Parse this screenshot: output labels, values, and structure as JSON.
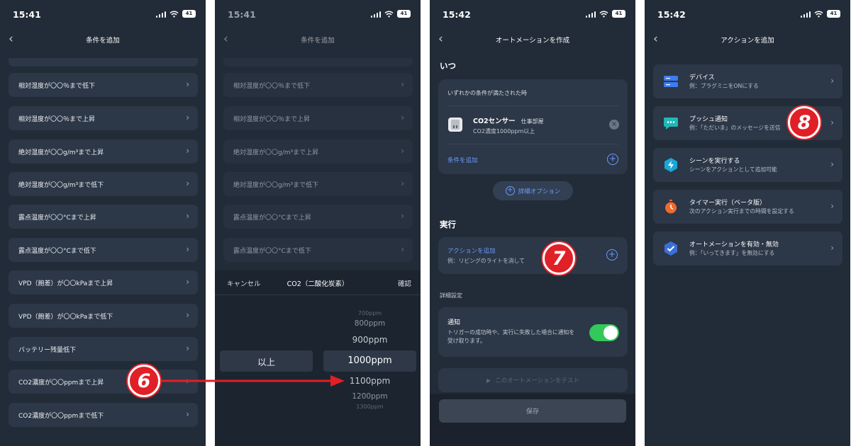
{
  "screens": [
    {
      "time": "15:41",
      "battery": "41",
      "title": "条件を追加",
      "rows": [
        "相対湿度が〇〇％まで低下",
        "相対湿度が〇〇％まで上昇",
        "絶対湿度が〇〇g/m³まで上昇",
        "絶対湿度が〇〇g/m³まで低下",
        "露点温度が〇〇°Cまで上昇",
        "露点温度が〇〇°Cまで低下",
        "VPD（飽差）が〇〇kPaまで上昇",
        "VPD（飽差）が〇〇kPaまで低下",
        "バッテリー残量低下",
        "CO2濃度が〇〇ppmまで上昇",
        "CO2濃度が〇〇ppmまで低下"
      ]
    },
    {
      "time": "15:41",
      "battery": "41",
      "title": "条件を追加",
      "rows": [
        "相対湿度が〇〇％まで低下",
        "相対湿度が〇〇％まで上昇",
        "絶対湿度が〇〇g/m³まで上昇",
        "絶対湿度が〇〇g/m³まで低下",
        "露点温度が〇〇°Cまで上昇",
        "露点温度が〇〇°Cまで低下"
      ],
      "picker": {
        "cancel": "キャンセル",
        "title": "CO2（二酸化炭素）",
        "confirm": "確認",
        "left_value": "以上",
        "values": [
          "700ppm",
          "800ppm",
          "900ppm",
          "1000ppm",
          "1100ppm",
          "1200ppm",
          "1300ppm"
        ],
        "selected": "1000ppm"
      }
    },
    {
      "time": "15:42",
      "battery": "41",
      "title": "オートメーションを作成",
      "when_header": "いつ",
      "when_mode": "いずれかの条件が満たされた時",
      "condition_name": "CO2センサー",
      "condition_room": "仕事部屋",
      "condition_detail": "CO2濃度1000ppm以上",
      "add_condition": "条件を追加",
      "advanced_options": "詳細オプション",
      "do_header": "実行",
      "add_action": "アクションを追加",
      "add_action_example": "例：リビングのライトを消して",
      "settings_header": "詳細設定",
      "notify_title": "通知",
      "notify_desc": "トリガーの成功時や、実行に失敗した場合に通知を受け取ります。",
      "notify_enabled": true,
      "test_button": "このオートメーションをテスト",
      "save_button": "保存"
    },
    {
      "time": "15:42",
      "battery": "41",
      "title": "アクションを追加",
      "actions": [
        {
          "title": "デバイス",
          "sub": "例：プラグミニをONにする",
          "icon": "device-icon"
        },
        {
          "title": "プッシュ通知",
          "sub": "例：「ただいま」のメッセージを送信",
          "icon": "chat-bubble-icon"
        },
        {
          "title": "シーンを実行する",
          "sub": "シーンをアクションとして追加可能",
          "icon": "scene-bolt-icon"
        },
        {
          "title": "タイマー実行（ベータ版）",
          "sub": "次のアクション実行までの時間を設定する",
          "icon": "stopwatch-icon"
        },
        {
          "title": "オートメーションを有効・無効",
          "sub": "例：「いってきます」を無効にする",
          "icon": "shield-check-icon"
        }
      ]
    }
  ],
  "annotations": {
    "step6": "6",
    "step7": "7",
    "step8": "8"
  },
  "colors": {
    "background": "#222b38",
    "card": "#2c3747",
    "accent": "#6d9bff",
    "toggle_on": "#34c759",
    "badge": "#e11f26"
  }
}
